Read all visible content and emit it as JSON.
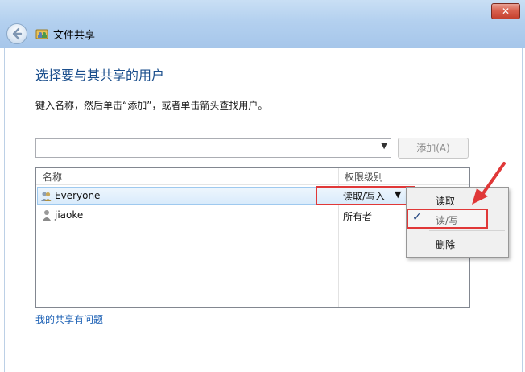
{
  "window": {
    "title": "文件共享",
    "close_label": "✕"
  },
  "heading": "选择要与其共享的用户",
  "instruction": "键入名称，然后单击“添加”，或者单击箭头查找用户。",
  "search": {
    "value": "",
    "placeholder": ""
  },
  "add_button": "添加(A)",
  "table": {
    "columns": [
      "名称",
      "权限级别"
    ],
    "rows": [
      {
        "name": "Everyone",
        "permission": "读取/写入",
        "selected": true
      },
      {
        "name": "jiaoke",
        "permission": "所有者",
        "selected": false
      }
    ]
  },
  "permission_menu": {
    "items": [
      {
        "label": "读取",
        "checked": false
      },
      {
        "label": "读/写",
        "checked": true
      },
      {
        "label": "删除",
        "checked": false
      }
    ]
  },
  "help_link": "我的共享有问题",
  "colors": {
    "accent": "#1b4f8d",
    "annotation": "#e03838",
    "link": "#1a5fb4"
  }
}
